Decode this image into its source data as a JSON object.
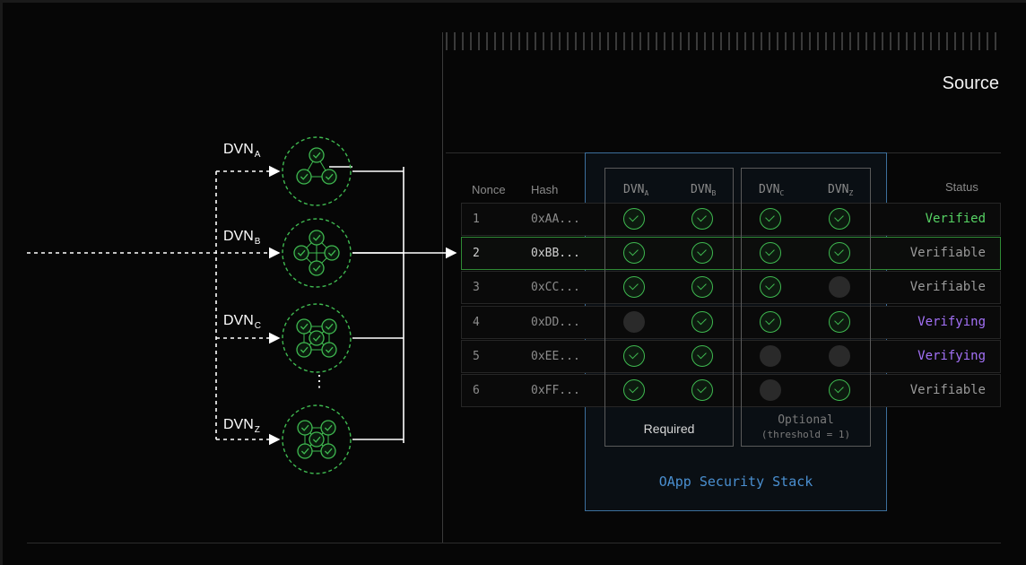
{
  "header": {
    "title": "Source"
  },
  "dvns": [
    {
      "name": "DVN",
      "sub": "A"
    },
    {
      "name": "DVN",
      "sub": "B"
    },
    {
      "name": "DVN",
      "sub": "C"
    },
    {
      "name": "DVN",
      "sub": "Z"
    }
  ],
  "ellipsis": "⋮",
  "table": {
    "headers": {
      "nonce": "Nonce",
      "hash": "Hash",
      "status": "Status"
    },
    "dvn_columns": [
      {
        "name": "DVN",
        "sub": "A"
      },
      {
        "name": "DVN",
        "sub": "B"
      },
      {
        "name": "DVN",
        "sub": "C"
      },
      {
        "name": "DVN",
        "sub": "Z"
      }
    ],
    "rows": [
      {
        "nonce": "1",
        "hash": "0xAA...",
        "checks": [
          true,
          true,
          true,
          true
        ],
        "status": "Verified"
      },
      {
        "nonce": "2",
        "hash": "0xBB...",
        "checks": [
          true,
          true,
          true,
          true
        ],
        "status": "Verifiable"
      },
      {
        "nonce": "3",
        "hash": "0xCC...",
        "checks": [
          true,
          true,
          true,
          false
        ],
        "status": "Verifiable"
      },
      {
        "nonce": "4",
        "hash": "0xDD...",
        "checks": [
          false,
          true,
          true,
          true
        ],
        "status": "Verifying"
      },
      {
        "nonce": "5",
        "hash": "0xEE...",
        "checks": [
          true,
          true,
          false,
          false
        ],
        "status": "Verifying"
      },
      {
        "nonce": "6",
        "hash": "0xFF...",
        "checks": [
          true,
          true,
          false,
          true
        ],
        "status": "Verifiable"
      }
    ]
  },
  "panel": {
    "required_label": "Required",
    "optional_label": "Optional",
    "optional_threshold": "(threshold = 1)",
    "stack_label": "OApp Security Stack"
  },
  "colors": {
    "check_green": "#3fb950",
    "verified_green": "#56d364",
    "verifying_purple": "#a371f7",
    "verifiable_gray": "#9a9a9a",
    "stack_blue": "#4a8fd0"
  }
}
